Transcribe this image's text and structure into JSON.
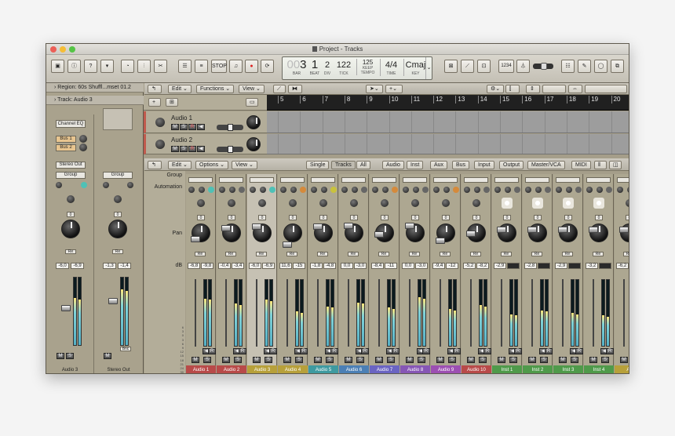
{
  "window": {
    "title": "Project - Tracks"
  },
  "toolbar": {
    "stop_label": "STOP",
    "lcd": {
      "bar": "3",
      "bar_label": "BAR",
      "beat": "1",
      "beat_label": "BEAT",
      "div": "2",
      "div_label": "DIV",
      "tick": "122",
      "tick_label": "TICK",
      "tempo": "125",
      "tempo_mode": "KEEP",
      "tempo_label": "TEMPO",
      "time_sig": "4/4",
      "time_label": "TIME",
      "key": "Cmaj",
      "key_label": "KEY"
    },
    "count_in": "1234"
  },
  "inspector": {
    "region_label": "Region:  60s Shuffl...mset 01.2",
    "track_label": "Track:  Audio 3",
    "channel_eq": "Channel EQ",
    "bus1": "Bus 1",
    "bus2": "Bus 2",
    "stereo_out": "Stereo Out",
    "group": "Group",
    "strip_left": {
      "name": "Audio 3",
      "db_a": "-6,0",
      "db_b": "-6,9"
    },
    "strip_right": {
      "name": "Stereo Out",
      "db_a": "-1,3",
      "db_b": "-1,4",
      "bnc": "Bnc"
    }
  },
  "tracks_area": {
    "menus": [
      "Edit",
      "Functions",
      "View"
    ],
    "ruler": [
      "5",
      "6",
      "7",
      "8",
      "9",
      "10",
      "11",
      "12",
      "13",
      "14",
      "15",
      "16",
      "17",
      "18",
      "19",
      "20"
    ],
    "tracks": [
      {
        "name": "Audio 1"
      },
      {
        "name": "Audio 2"
      }
    ]
  },
  "mixer": {
    "menus": [
      "Edit",
      "Options",
      "View"
    ],
    "scope": [
      "Single",
      "Tracks",
      "All"
    ],
    "filters": [
      "Audio",
      "Inst",
      "Aux",
      "Bus",
      "Input",
      "Output",
      "Master/VCA",
      "MIDI"
    ],
    "row_labels": {
      "group": "Group",
      "automation": "Automation",
      "pan": "Pan",
      "db": "dB"
    },
    "pan_value": "0",
    "read_label": "Re",
    "channels": [
      {
        "name": "Audio 1",
        "db_a": "-6,8",
        "db_b": "-9,8",
        "color": "#b84a49"
      },
      {
        "name": "Audio 2",
        "db_a": "-0,4",
        "db_b": "-3,4",
        "color": "#b84a49"
      },
      {
        "name": "Audio 3",
        "db_a": "-6,0",
        "db_b": "-6,9",
        "color": "#b7a03a"
      },
      {
        "name": "Audio 4",
        "db_a": "11,6",
        "db_b": "-15",
        "color": "#b7a03a"
      },
      {
        "name": "Audio 5",
        "db_a": "-1,8",
        "db_b": "-4,8",
        "color": "#3e9aa0"
      },
      {
        "name": "Audio 6",
        "db_a": "0,0",
        "db_b": "-3,0",
        "color": "#4b7fb5"
      },
      {
        "name": "Audio 7",
        "db_a": "-8,4",
        "db_b": "-11",
        "color": "#6a64c2"
      },
      {
        "name": "Audio 8",
        "db_a": "0,0",
        "db_b": "-3,0",
        "color": "#8656b5"
      },
      {
        "name": "Audio 9",
        "db_a": "-9,4",
        "db_b": "-12",
        "color": "#9c4fb2"
      },
      {
        "name": "Audio 10",
        "db_a": "-5,2",
        "db_b": "-8,2",
        "color": "#b84a49"
      },
      {
        "name": "Inst 1",
        "db_a": "-2,9",
        "db_b": "",
        "color": "#4f9a4a"
      },
      {
        "name": "Inst 2",
        "db_a": "-2,8",
        "db_b": "",
        "color": "#4f9a4a"
      },
      {
        "name": "Inst 3",
        "db_a": "-2,9",
        "db_b": "",
        "color": "#4f9a4a"
      },
      {
        "name": "Inst 4",
        "db_a": "-3,2",
        "db_b": "",
        "color": "#4f9a4a"
      },
      {
        "name": "Au",
        "db_a": "-6,2",
        "db_b": "",
        "color": "#b7a03a"
      }
    ],
    "scale": [
      "6",
      "3",
      "0",
      "3",
      "6",
      "9",
      "12",
      "15",
      "18",
      "21",
      "24",
      "30",
      "35",
      "40",
      "45",
      "50",
      "60"
    ]
  }
}
